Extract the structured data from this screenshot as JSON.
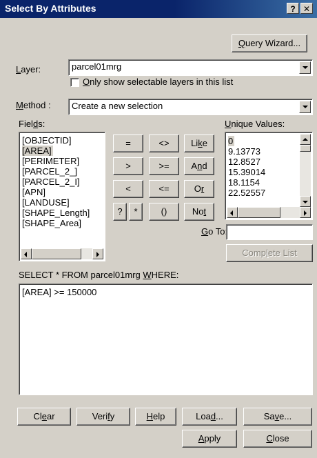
{
  "window": {
    "title": "Select By Attributes",
    "help_glyph": "?",
    "close_glyph": "✕"
  },
  "query_wizard": {
    "pre": "",
    "accel": "Q",
    "post": "uery Wizard..."
  },
  "layer": {
    "label_accel": "L",
    "label_rest": "ayer:",
    "value": "parcel01mrg",
    "checkbox_accel": "O",
    "checkbox_rest": "nly show selectable layers in this list",
    "checked": false
  },
  "method": {
    "label_accel": "M",
    "label_rest": "ethod :",
    "value": "Create a new selection"
  },
  "fields": {
    "label_pre": "Fiel",
    "label_accel": "d",
    "label_post": "s:",
    "items": [
      "[OBJECTID]",
      "[AREA]",
      "[PERIMETER]",
      "[PARCEL_2_]",
      "[PARCEL_2_I]",
      "[APN]",
      "[LANDUSE]",
      "[SHAPE_Length]",
      "[SHAPE_Area]"
    ],
    "selected": "[AREA]"
  },
  "operators": {
    "eq": "=",
    "ne": "<>",
    "like_pre": "Li",
    "like_accel": "k",
    "like_post": "e",
    "gt": ">",
    "ge": ">=",
    "and_pre": "A",
    "and_accel": "n",
    "and_post": "d",
    "lt": "<",
    "le": "<=",
    "or_pre": "O",
    "or_accel": "r",
    "or_post": "",
    "q": "?",
    "star": "*",
    "paren": "()",
    "not_pre": "No",
    "not_accel": "t",
    "not_post": ""
  },
  "unique_values": {
    "label_accel": "U",
    "label_rest": "nique Values:",
    "items": [
      "0",
      "9.13773",
      "12.8527",
      "15.39014",
      "18.1154",
      "22.52557"
    ],
    "selected": "0"
  },
  "goto": {
    "label_accel": "G",
    "label_rest": "o To:",
    "value": ""
  },
  "complete_list": {
    "pre": "Comp",
    "accel": "l",
    "post": "ete List"
  },
  "query": {
    "prefix_pre": "SELECT * FROM parcel01mrg ",
    "prefix_accel": "W",
    "prefix_post": "HERE:",
    "expression": "[AREA] >= 150000"
  },
  "buttons": {
    "clear_pre": "Cl",
    "clear_accel": "e",
    "clear_post": "ar",
    "verify_pre": "Veri",
    "verify_accel": "f",
    "verify_post": "y",
    "help_pre": "",
    "help_accel": "H",
    "help_post": "elp",
    "load_pre": "Loa",
    "load_accel": "d",
    "load_post": "...",
    "save_pre": "Sa",
    "save_accel": "v",
    "save_post": "e...",
    "apply_pre": "",
    "apply_accel": "A",
    "apply_post": "pply",
    "close_pre": "",
    "close_accel": "C",
    "close_post": "lose"
  }
}
